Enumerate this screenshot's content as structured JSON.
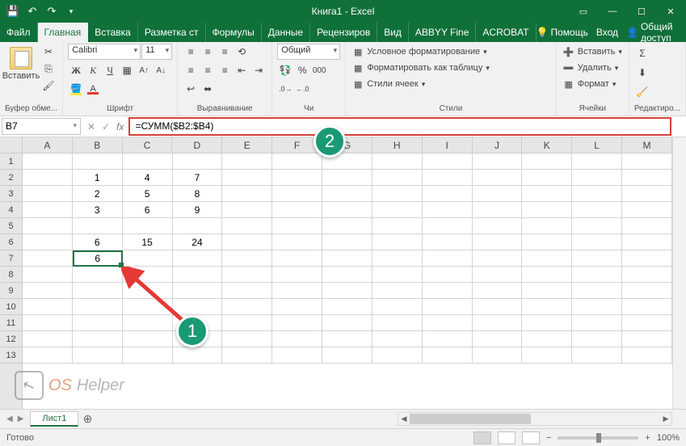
{
  "title": "Книга1 - Excel",
  "tabs": {
    "file": "Файл",
    "home": "Главная",
    "insert": "Вставка",
    "layout": "Разметка ст",
    "formulas": "Формулы",
    "data": "Данные",
    "review": "Рецензиров",
    "view": "Вид",
    "abbyy": "ABBYY Fine",
    "acrobat": "ACROBAT"
  },
  "topright": {
    "help": "Помощь",
    "signin": "Вход",
    "share": "Общий доступ"
  },
  "ribbon": {
    "paste": "Вставить",
    "clipboard_label": "Буфер обме...",
    "font_name": "Calibri",
    "font_size": "11",
    "font_label": "Шрифт",
    "align_label": "Выравнивание",
    "number_format": "Общий",
    "number_label": "Чи",
    "styles": {
      "conditional": "Условное форматирование",
      "table": "Форматировать как таблицу",
      "cell": "Стили ячеек",
      "label": "Стили"
    },
    "cells": {
      "insert": "Вставить",
      "delete": "Удалить",
      "format": "Формат",
      "label": "Ячейки"
    },
    "editing_label": "Редактиро..."
  },
  "namebox": "B7",
  "formula": "=СУММ($B2:$B4)",
  "columns": [
    "A",
    "B",
    "C",
    "D",
    "E",
    "F",
    "G",
    "H",
    "I",
    "J",
    "K",
    "L",
    "M"
  ],
  "rows": [
    "1",
    "2",
    "3",
    "4",
    "5",
    "6",
    "7",
    "8",
    "9",
    "10",
    "11",
    "12",
    "13"
  ],
  "cells": {
    "r2": {
      "B": "1",
      "C": "4",
      "D": "7"
    },
    "r3": {
      "B": "2",
      "C": "5",
      "D": "8"
    },
    "r4": {
      "B": "3",
      "C": "6",
      "D": "9"
    },
    "r6": {
      "B": "6",
      "C": "15",
      "D": "24"
    },
    "r7": {
      "B": "6"
    }
  },
  "sheet_tab": "Лист1",
  "status": "Готово",
  "zoom": "100%",
  "annotations": {
    "a1": "1",
    "a2": "2"
  },
  "watermark": {
    "t1": "OS",
    "t2": "Helper"
  }
}
